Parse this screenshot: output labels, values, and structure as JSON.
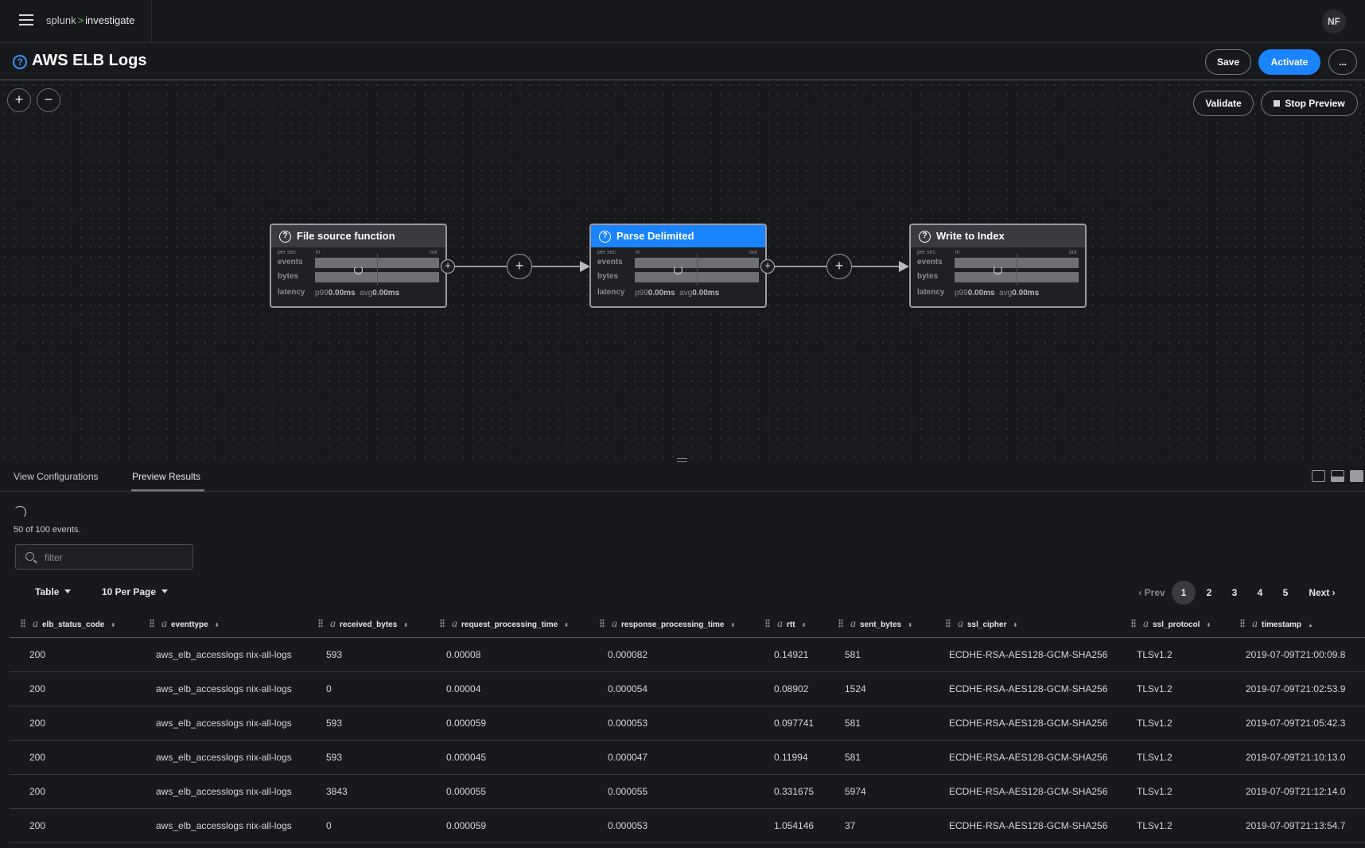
{
  "topbar": {
    "brand": "splunk",
    "brand_sep": ">",
    "app_name": "investigate",
    "user_initials": "NF"
  },
  "header": {
    "title": "AWS ELB Logs",
    "save_label": "Save",
    "activate_label": "Activate",
    "more_label": "..."
  },
  "canvas": {
    "zoom_in": "+",
    "zoom_out": "−",
    "validate_label": "Validate",
    "stop_preview_label": "Stop Preview",
    "add_label": "+",
    "nodes": [
      {
        "title": "File source function",
        "per_sec": "per sec",
        "in": "in",
        "out": "out",
        "events": "events",
        "bytes": "bytes",
        "latency": "latency",
        "p99_label": "p99",
        "p99": "0.00ms",
        "avg_label": "avg",
        "avg": "0.00ms"
      },
      {
        "title": "Parse Delimited",
        "per_sec": "per sec",
        "in": "in",
        "out": "out",
        "events": "events",
        "bytes": "bytes",
        "latency": "latency",
        "p99_label": "p99",
        "p99": "0.00ms",
        "avg_label": "avg",
        "avg": "0.00ms"
      },
      {
        "title": "Write to Index",
        "per_sec": "per sec",
        "in": "in",
        "out": "out",
        "events": "events",
        "bytes": "bytes",
        "latency": "latency",
        "p99_label": "p99",
        "p99": "0.00ms",
        "avg_label": "avg",
        "avg": "0.00ms"
      }
    ]
  },
  "panel": {
    "tabs": [
      "View Configurations",
      "Preview Results"
    ],
    "active_tab": "Preview Results",
    "event_count": "50 of 100 events.",
    "filter_placeholder": "filter",
    "view_mode": "Table",
    "per_page": "10 Per Page",
    "pagination": {
      "prev": "Prev",
      "pages": [
        "1",
        "2",
        "3",
        "4",
        "5"
      ],
      "current": "1",
      "next": "Next"
    }
  },
  "table": {
    "type_glyph": "a",
    "columns": [
      "elb_status_code",
      "eventtype",
      "received_bytes",
      "request_processing_time",
      "response_processing_time",
      "rtt",
      "sent_bytes",
      "ssl_cipher",
      "ssl_protocol",
      "timestamp"
    ],
    "rows": [
      [
        "200",
        "aws_elb_accesslogs nix-all-logs",
        "593",
        "0.00008",
        "0.000082",
        "0.14921",
        "581",
        "ECDHE-RSA-AES128-GCM-SHA256",
        "TLSv1.2",
        "2019-07-09T21:00:09.8"
      ],
      [
        "200",
        "aws_elb_accesslogs nix-all-logs",
        "0",
        "0.00004",
        "0.000054",
        "0.08902",
        "1524",
        "ECDHE-RSA-AES128-GCM-SHA256",
        "TLSv1.2",
        "2019-07-09T21:02:53.9"
      ],
      [
        "200",
        "aws_elb_accesslogs nix-all-logs",
        "593",
        "0.000059",
        "0.000053",
        "0.097741",
        "581",
        "ECDHE-RSA-AES128-GCM-SHA256",
        "TLSv1.2",
        "2019-07-09T21:05:42.3"
      ],
      [
        "200",
        "aws_elb_accesslogs nix-all-logs",
        "593",
        "0.000045",
        "0.000047",
        "0.11994",
        "581",
        "ECDHE-RSA-AES128-GCM-SHA256",
        "TLSv1.2",
        "2019-07-09T21:10:13.0"
      ],
      [
        "200",
        "aws_elb_accesslogs nix-all-logs",
        "3843",
        "0.000055",
        "0.000055",
        "0.331675",
        "5974",
        "ECDHE-RSA-AES128-GCM-SHA256",
        "TLSv1.2",
        "2019-07-09T21:12:14.0"
      ],
      [
        "200",
        "aws_elb_accesslogs nix-all-logs",
        "0",
        "0.000059",
        "0.000053",
        "1.054146",
        "37",
        "ECDHE-RSA-AES128-GCM-SHA256",
        "TLSv1.2",
        "2019-07-09T21:13:54.7"
      ]
    ]
  }
}
